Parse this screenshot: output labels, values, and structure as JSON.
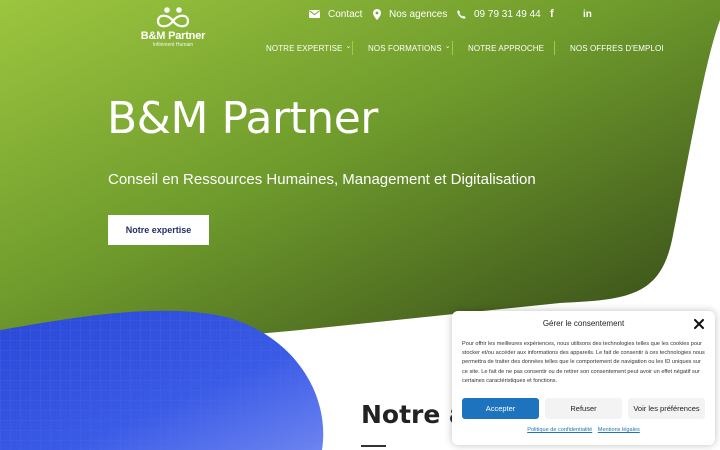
{
  "brand": {
    "name": "B&M Partner",
    "tagline": "Infiniment Humain"
  },
  "topbar": {
    "contact": {
      "label": "Contact",
      "icon": "envelope-icon"
    },
    "agencies": {
      "label": "Nos agences",
      "icon": "map-pin-icon"
    },
    "phone": {
      "label": "09 79 31 49 44",
      "icon": "phone-icon"
    },
    "social": [
      {
        "icon": "facebook-icon"
      },
      {
        "icon": "linkedin-icon"
      }
    ]
  },
  "nav": {
    "items": [
      {
        "label": "NOTRE EXPERTISE",
        "dropdown": true
      },
      {
        "label": "NOS FORMATIONS",
        "dropdown": true
      },
      {
        "label": "NOTRE APPROCHE",
        "dropdown": false
      },
      {
        "label": "NOS OFFRES D'EMPLOI",
        "dropdown": false
      }
    ],
    "caret": "⌄"
  },
  "hero": {
    "title": "B&M Partner",
    "subtitle": "Conseil en Ressources Humaines, Management et Digitalisation",
    "cta_label": "Notre expertise"
  },
  "section": {
    "heading": "Notre ap"
  },
  "consent": {
    "title": "Gérer le consentement",
    "body": "Pour offrir les meilleures expériences, nous utilisons des technologies telles que les cookies pour stocker et/ou accéder aux informations des appareils. Le fait de consentir à ces technologies nous permettra de traiter des données telles que le comportement de navigation ou les ID uniques sur ce site. Le fait de ne pas consentir ou de retirer son consentement peut avoir un effet négatif sur certaines caractéristiques et fonctions.",
    "accept_label": "Accepter",
    "refuse_label": "Refuser",
    "prefs_label": "Voir les préférences",
    "privacy_link": "Politique de confidentialité",
    "legal_link": "Mentions légales"
  },
  "colors": {
    "hero_green_light": "#8dba3a",
    "hero_green_dark": "#3b4f1c",
    "accent_blue": "#1e73be",
    "button_text_navy": "#24306a",
    "nav_separator": "#9bd23a",
    "photo_blue": "#2f4fd8"
  }
}
